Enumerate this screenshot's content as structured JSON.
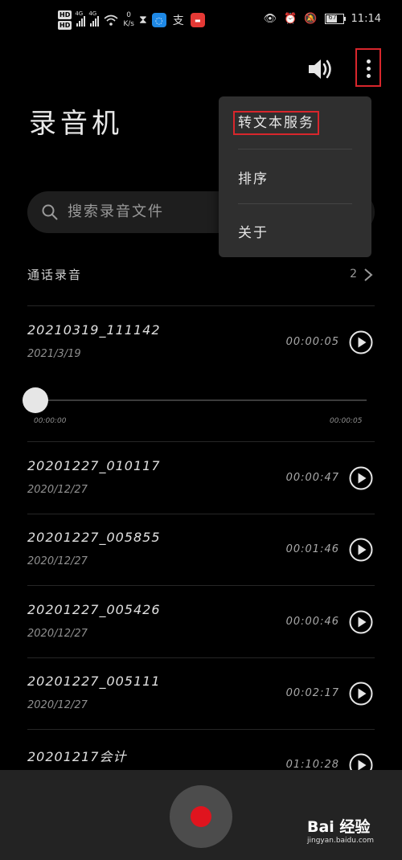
{
  "status_bar": {
    "hd_labels": [
      "HD",
      "HD"
    ],
    "network_labels": [
      "4G",
      "4G"
    ],
    "speed_value": "0",
    "speed_unit": "K/s",
    "battery": "67",
    "time": "11:14"
  },
  "header": {
    "title": "录音机"
  },
  "search": {
    "placeholder": "搜索录音文件"
  },
  "menu": {
    "items": [
      {
        "label": "转文本服务"
      },
      {
        "label": "排序"
      },
      {
        "label": "关于"
      }
    ]
  },
  "call_recordings": {
    "label": "通话录音",
    "count": "2"
  },
  "recordings": [
    {
      "name": "20210319_111142",
      "date": "2021/3/19",
      "duration": "00:00:05"
    },
    {
      "name": "20201227_010117",
      "date": "2020/12/27",
      "duration": "00:00:47"
    },
    {
      "name": "20201227_005855",
      "date": "2020/12/27",
      "duration": "00:01:46"
    },
    {
      "name": "20201227_005426",
      "date": "2020/12/27",
      "duration": "00:00:46"
    },
    {
      "name": "20201227_005111",
      "date": "2020/12/27",
      "duration": "00:02:17"
    },
    {
      "name": "20201217会计",
      "date": "",
      "duration": "01:10:28"
    }
  ],
  "player": {
    "current_time": "00:00:00",
    "total_time": "00:00:05",
    "progress": 0
  },
  "colors": {
    "accent_red": "#e0141e",
    "highlight_box": "#d8262c",
    "background": "#000000"
  },
  "watermark": {
    "logo": "Bai 经验",
    "url": "jingyan.baidu.com"
  }
}
